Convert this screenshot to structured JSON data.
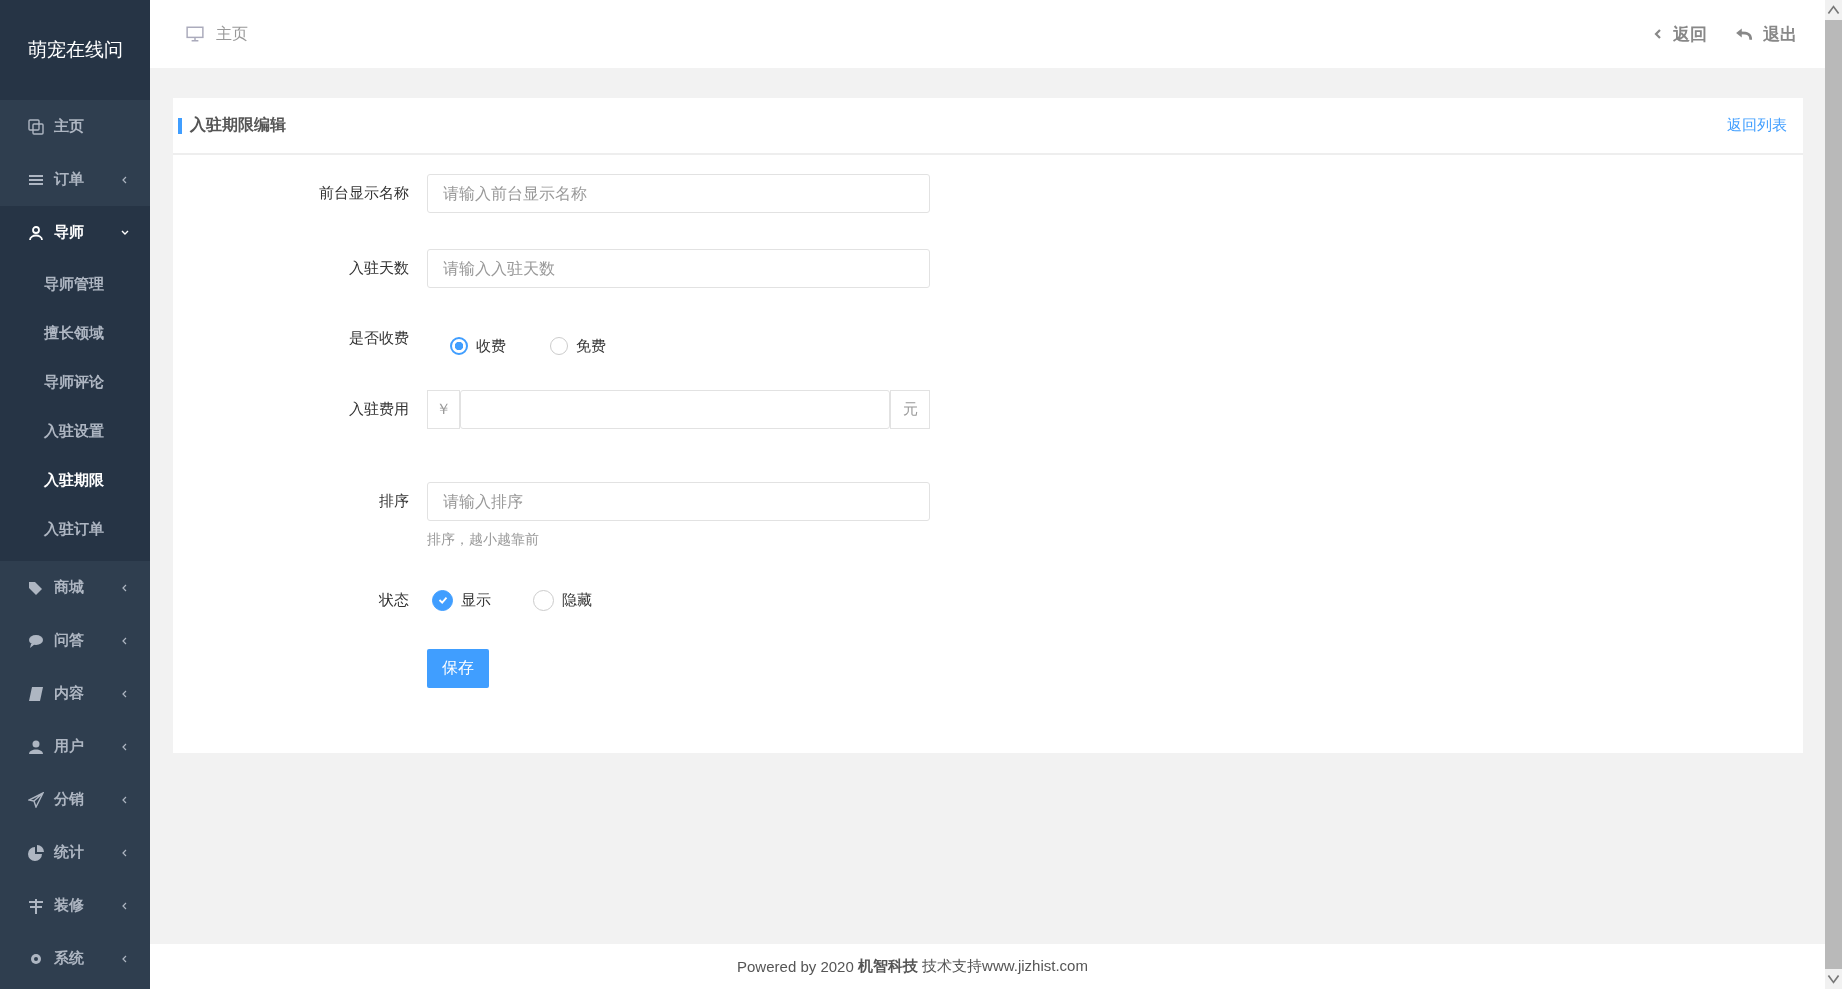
{
  "app": {
    "title": "萌宠在线问"
  },
  "sidebar": {
    "items": [
      {
        "label": "主页",
        "kind": "link",
        "expanded": false
      },
      {
        "label": "订单",
        "kind": "group",
        "expanded": false
      },
      {
        "label": "导师",
        "kind": "group",
        "expanded": true,
        "children": [
          {
            "label": "导师管理",
            "selected": false
          },
          {
            "label": "擅长领域",
            "selected": false
          },
          {
            "label": "导师评论",
            "selected": false
          },
          {
            "label": "入驻设置",
            "selected": false
          },
          {
            "label": "入驻期限",
            "selected": true
          },
          {
            "label": "入驻订单",
            "selected": false
          }
        ]
      },
      {
        "label": "商城",
        "kind": "group",
        "expanded": false
      },
      {
        "label": "问答",
        "kind": "group",
        "expanded": false
      },
      {
        "label": "内容",
        "kind": "group",
        "expanded": false
      },
      {
        "label": "用户",
        "kind": "group",
        "expanded": false
      },
      {
        "label": "分销",
        "kind": "group",
        "expanded": false
      },
      {
        "label": "统计",
        "kind": "group",
        "expanded": false
      },
      {
        "label": "装修",
        "kind": "group",
        "expanded": false
      },
      {
        "label": "系统",
        "kind": "group",
        "expanded": false
      }
    ]
  },
  "header": {
    "breadcrumb": "主页",
    "back": "返回",
    "logout": "退出"
  },
  "card": {
    "title": "入驻期限编辑",
    "back_link": "返回列表",
    "fields": [
      {
        "kind": "text",
        "label": "前台显示名称",
        "placeholder": "请输入前台显示名称"
      },
      {
        "kind": "text",
        "label": "入驻天数",
        "placeholder": "请输入入驻天数"
      },
      {
        "kind": "radio",
        "label": "是否收费",
        "options": [
          {
            "label": "收费",
            "selected": true
          },
          {
            "label": "免费",
            "selected": false
          }
        ]
      },
      {
        "kind": "addon",
        "label": "入驻费用",
        "prefix": "￥",
        "suffix": "元"
      },
      {
        "kind": "text",
        "label": "排序",
        "placeholder": "请输入排序",
        "help": "排序，越小越靠前"
      },
      {
        "kind": "check",
        "label": "状态",
        "options": [
          {
            "label": "显示",
            "selected": true
          },
          {
            "label": "隐藏",
            "selected": false
          }
        ]
      }
    ],
    "save": "保存"
  },
  "footer": {
    "prefix": "Powered by 2020 ",
    "company": "机智科技",
    "suffix": " 技术支持www.jizhist.com"
  }
}
